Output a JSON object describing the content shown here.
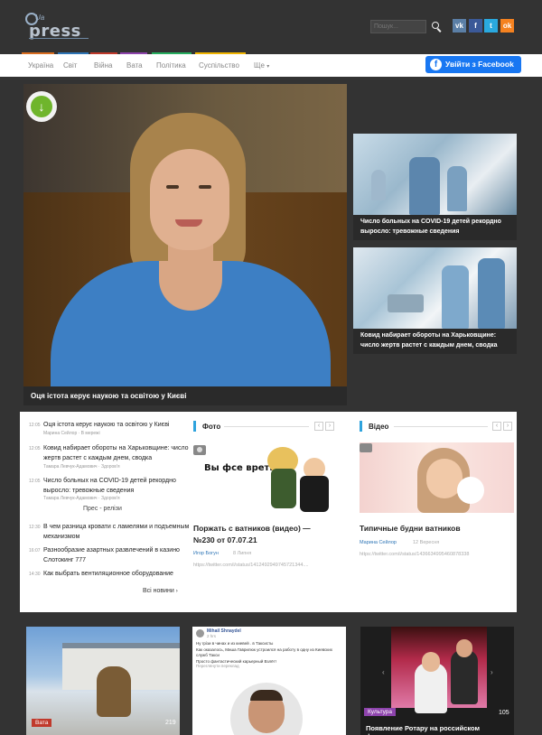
{
  "header": {
    "logo_sub": "Ua",
    "logo_word": "press",
    "search_placeholder": "Пошук...",
    "social": [
      "vk",
      "f",
      "t",
      "ok"
    ]
  },
  "nav": {
    "items": [
      "Україна",
      "Світ",
      "Війна",
      "Вата",
      "Політика",
      "Суспільство",
      "Ще"
    ],
    "accent_colors": [
      "#d96d20",
      "#2e75b6",
      "#c0392b",
      "#8e44ad",
      "#27ae60",
      "#f0b400"
    ],
    "fb_login": "Увійти з Facebook"
  },
  "hero": {
    "caption": "Оця істота керує наукою та освітою у Києві"
  },
  "side_stories": [
    {
      "title": "Число больных на COVID-19 детей рекордно выросло: тревожные сведения"
    },
    {
      "title": "Ковид набирает обороты на Харьковщине: число жертв растет с каждым днем, сводка"
    }
  ],
  "news_list": [
    {
      "time": "12:05",
      "title": "Оця істота керує наукою та освітою у Києві",
      "meta": "Марина Сейлор · В мережі"
    },
    {
      "time": "12:05",
      "title": "Ковид набирает обороты на Харьковщине: число жертв растет с каждым днем, сводка",
      "meta": "Тамара Левчук-Адамович · Здоров'я"
    },
    {
      "time": "12:05",
      "title": "Число больных на COVID-19 детей рекордно выросло: тревожные сведения",
      "meta": "Тамара Левчук-Адамович · Здоров'я"
    }
  ],
  "press": {
    "heading": "Прес - релізи",
    "items": [
      {
        "time": "12:30",
        "title": "В чем разница кровати с ламелями и подъемным механизмом"
      },
      {
        "time": "16:07",
        "title": "Разнообразие азартных развлечений в казино Слотокинг 777"
      },
      {
        "time": "14:30",
        "title": "Как выбрать вентиляционное оборудование"
      }
    ],
    "all_news": "Всі новини"
  },
  "photo_section": {
    "title": "Фото",
    "cartoon_text": "Вы фсе врети!!",
    "card_title": "Поржать с ватников (видео) — №230 от 07.07.21",
    "author": "Игор Богун",
    "date": "8 Липня",
    "link": "https://twitter.com/i/status/1412492949745721344...."
  },
  "video_section": {
    "title": "Відео",
    "card_title": "Типичные будни ватников",
    "author": "Марина Сейлор",
    "date": "12 Вересня",
    "link": "https://twitter.com/i/status/1436634995460878338"
  },
  "bottom": [
    {
      "tag": "Вата",
      "count": "219"
    },
    {
      "post_author": "Mihail Shnaydel",
      "post_time": "2 hrs",
      "post_lines": [
        "Ну грізи в чинах и из киевей . в Таксисты",
        "Как оказалось, Миша Гаврилюк устроился на работу в одну из Киевских служб Такси",
        "Просто фантастический карьерный Взлёт!"
      ],
      "translate": "Переглянути переклад"
    },
    {
      "tag": "Культура",
      "count": "105",
      "title": "Появление Ротару на российском фестивале"
    }
  ]
}
